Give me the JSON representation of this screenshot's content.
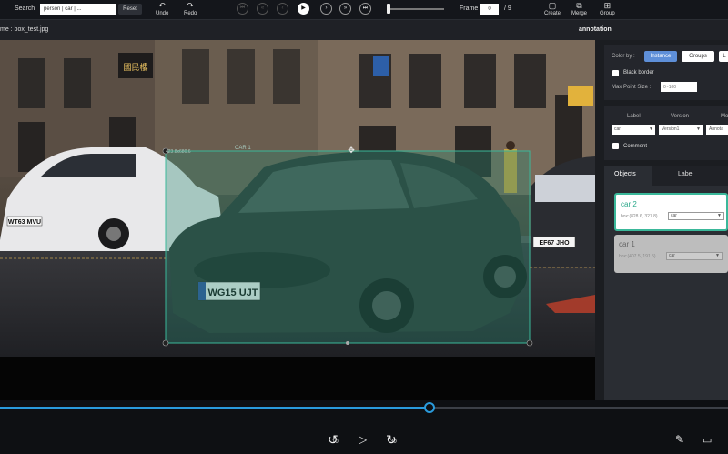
{
  "toolbar": {
    "search_label": "Search",
    "search_value": "person | car | ...",
    "reset_label": "Reset",
    "undo_label": "Undo",
    "redo_label": "Redo",
    "frame_label": "Frame",
    "frame_value": "0",
    "frame_total": "/ 9",
    "create_label": "Create",
    "merge_label": "Merge",
    "group_label": "Group"
  },
  "header": {
    "filename": "me : box_test.jpg",
    "panel_title": "annotation"
  },
  "panel": {
    "color_by_label": "Color by :",
    "color_by_options": [
      "Instance",
      "Groups",
      "L"
    ],
    "black_border_label": "Black border",
    "max_point_size_label": "Max Point Size :",
    "max_point_size_placeholder": "0~100",
    "label_header": "Label",
    "version_header": "Version",
    "mo_header": "Mo",
    "label_value": "car",
    "version_value": "Version1",
    "mo_value": "Annota",
    "comment_label": "Comment",
    "tabs": [
      "Objects",
      "Label",
      ""
    ]
  },
  "objects": [
    {
      "title": "car 2",
      "box": "box:(828.6, 327.8)",
      "class": "car",
      "active": true
    },
    {
      "title": "car 1",
      "box": "box:(407.5, 191.5)",
      "class": "car",
      "active": false
    }
  ],
  "canvas": {
    "bbox_main_label": "CAR 1",
    "bbox_size_label": "423.8x680.6",
    "plates": [
      "WT63 MVU",
      "WG15 UJT",
      "EF67 JHO"
    ],
    "shop_sign": "國民樓"
  },
  "timeline": {
    "progress": 0.59,
    "rewind_label": "10",
    "forward_label": "30"
  },
  "colors": {
    "accent": "#2a9bdc",
    "bbox": "#3ab89a",
    "instance_chip": "#5e8fd8"
  }
}
